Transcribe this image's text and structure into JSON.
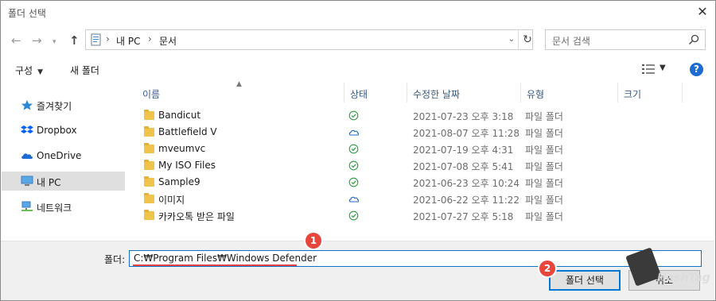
{
  "window": {
    "title": "폴더 선택"
  },
  "address": {
    "crumbs": [
      "내 PC",
      "문서"
    ]
  },
  "search": {
    "placeholder": "문서 검색"
  },
  "toolbar": {
    "organize": "구성",
    "new_folder": "새 폴더",
    "help": "?"
  },
  "sidebar": {
    "items": [
      {
        "label": "즐겨찾기",
        "icon": "star-icon"
      },
      {
        "label": "Dropbox",
        "icon": "dropbox-icon"
      },
      {
        "label": "OneDrive",
        "icon": "onedrive-icon"
      },
      {
        "label": "내 PC",
        "icon": "pc-icon"
      },
      {
        "label": "네트워크",
        "icon": "network-icon"
      }
    ]
  },
  "columns": {
    "name": "이름",
    "status": "상태",
    "modified": "수정한 날짜",
    "type": "유형",
    "size": "크기"
  },
  "files": [
    {
      "name": "Bandicut",
      "status": "synced",
      "modified": "2021-07-23 오후 3:18",
      "type": "파일 폴더"
    },
    {
      "name": "Battlefield V",
      "status": "cloud",
      "modified": "2021-08-07 오후 11:28",
      "type": "파일 폴더"
    },
    {
      "name": "mveumvc",
      "status": "synced",
      "modified": "2021-07-19 오후 4:31",
      "type": "파일 폴더"
    },
    {
      "name": "My ISO Files",
      "status": "synced",
      "modified": "2021-07-08 오후 5:41",
      "type": "파일 폴더"
    },
    {
      "name": "Sample9",
      "status": "synced",
      "modified": "2021-06-23 오후 10:24",
      "type": "파일 폴더"
    },
    {
      "name": "이미지",
      "status": "cloud",
      "modified": "2021-06-22 오후 11:22",
      "type": "파일 폴더"
    },
    {
      "name": "카카오톡 받은 파일",
      "status": "synced",
      "modified": "2021-07-27 오후 5:18",
      "type": "파일 폴더"
    }
  ],
  "footer": {
    "folder_label": "폴더:",
    "folder_value": "C:₩Program Files₩Windows Defender",
    "select_button": "폴더 선택",
    "cancel_button": "취소",
    "step1": "1",
    "step2": "2"
  },
  "watermark": {
    "text": "HashTag"
  },
  "colors": {
    "accent": "#0078d7",
    "badge": "#e8453c",
    "selected_bg": "#dfdfdf",
    "synced": "#2f9e44",
    "cloud": "#1c6cd3"
  }
}
